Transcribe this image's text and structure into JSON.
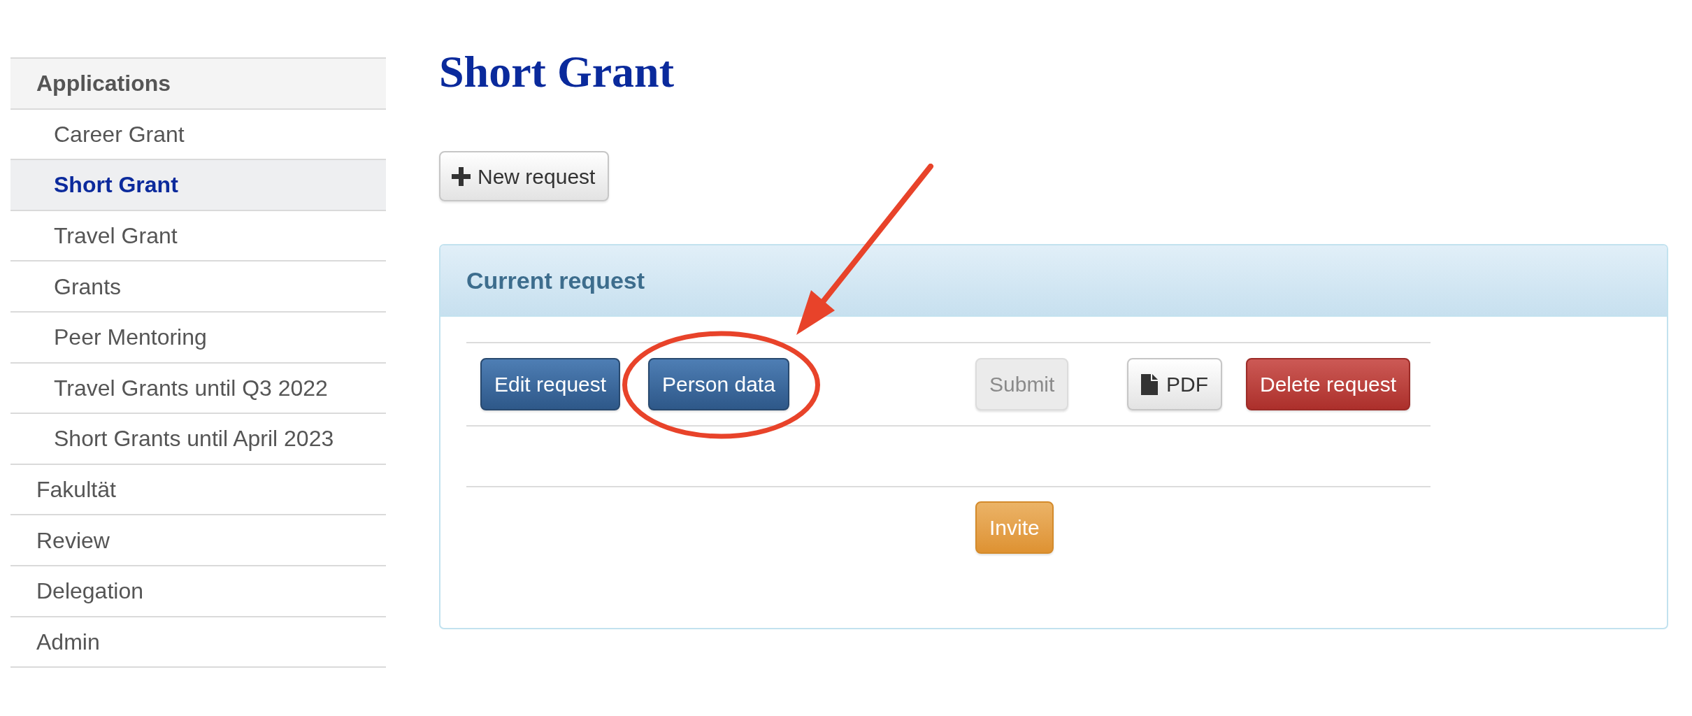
{
  "sidebar": {
    "items": [
      {
        "label": "Applications",
        "selected": false,
        "expanded": true,
        "children": [
          {
            "label": "Career Grant",
            "selected": false
          },
          {
            "label": "Short Grant",
            "selected": true
          },
          {
            "label": "Travel Grant",
            "selected": false
          },
          {
            "label": "Grants",
            "selected": false
          },
          {
            "label": "Peer Mentoring",
            "selected": false
          },
          {
            "label": "Travel Grants until Q3 2022",
            "selected": false
          },
          {
            "label": "Short Grants until April 2023",
            "selected": false
          }
        ]
      },
      {
        "label": "Fakultät",
        "selected": false,
        "expanded": false
      },
      {
        "label": "Review",
        "selected": false,
        "expanded": false
      },
      {
        "label": "Delegation",
        "selected": false,
        "expanded": false
      },
      {
        "label": "Admin",
        "selected": false,
        "expanded": false
      }
    ]
  },
  "page": {
    "title": "Short Grant",
    "new_button": {
      "label": "New request"
    }
  },
  "panel": {
    "title": "Current request",
    "rows": [
      {
        "cells": [
          {
            "buttons": [
              {
                "label": "Edit request",
                "kind": "primary",
                "disabled": false
              },
              {
                "label": "Person data",
                "kind": "primary",
                "disabled": false,
                "highlighted": true
              }
            ]
          },
          {
            "buttons": [
              {
                "label": "Submit",
                "kind": "plain",
                "disabled": true
              }
            ]
          },
          {
            "buttons": [
              {
                "label": "PDF",
                "kind": "document",
                "disabled": false
              }
            ]
          },
          {
            "buttons": [
              {
                "label": "Delete request",
                "kind": "danger",
                "disabled": false
              }
            ]
          }
        ]
      }
    ],
    "footer_buttons": [
      {
        "label": "Invite",
        "kind": "warning",
        "disabled": false
      }
    ]
  }
}
